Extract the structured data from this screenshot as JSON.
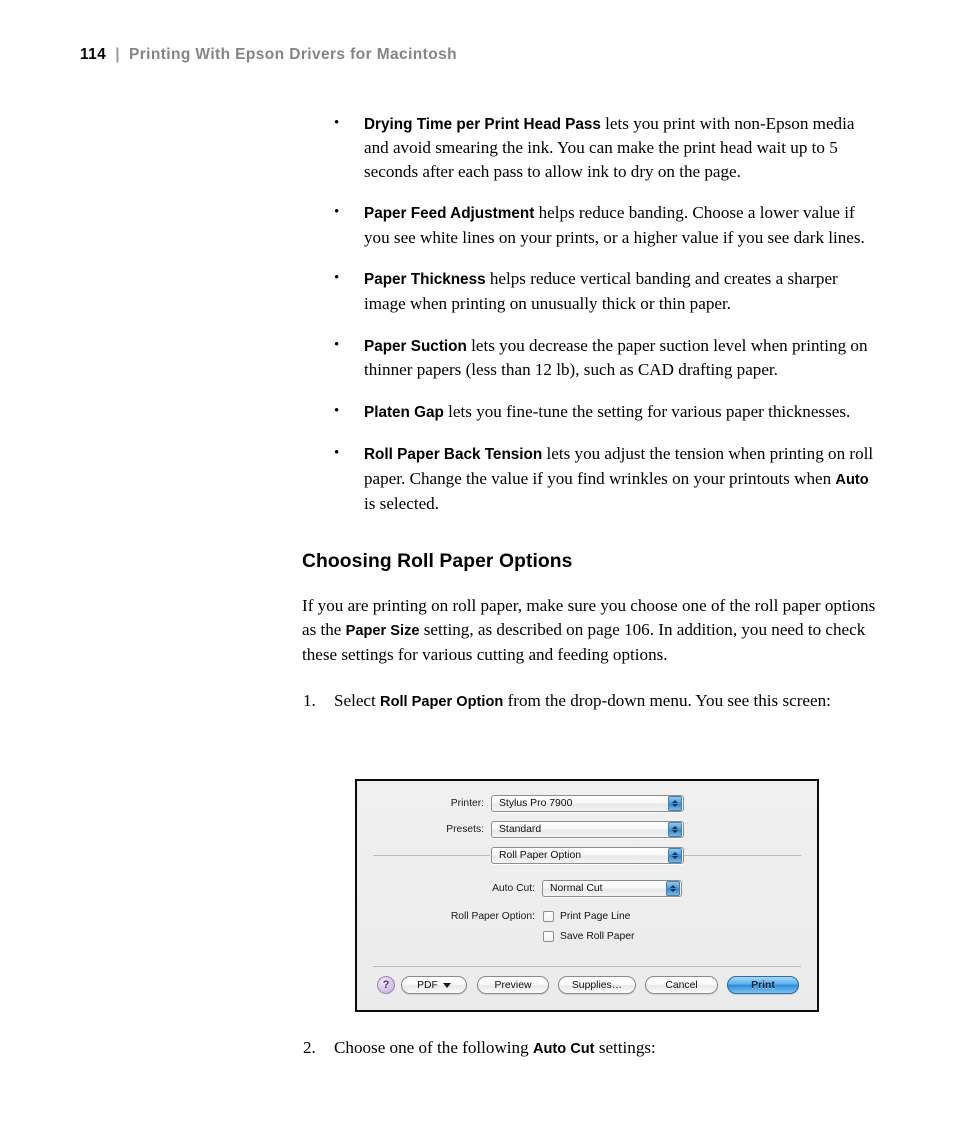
{
  "header": {
    "folio": "114",
    "separator": "|",
    "running_head": "Printing With Epson Drivers for Macintosh"
  },
  "bullets": [
    {
      "term": "Drying Time per Print Head Pass",
      "text": " lets you print with non-Epson media and avoid smearing the ink. You can make the print head wait up to 5 seconds after each pass to allow ink to dry on the page."
    },
    {
      "term": "Paper Feed Adjustment",
      "text": " helps reduce banding. Choose a lower value if you see white lines on your prints, or a higher value if you see dark lines."
    },
    {
      "term": "Paper Thickness",
      "text": " helps reduce vertical banding and creates a sharper image when printing on unusually thick or thin paper."
    },
    {
      "term": "Paper Suction",
      "text": " lets you decrease the paper suction level when printing on thinner papers (less than 12 lb), such as CAD drafting paper."
    },
    {
      "term": "Platen Gap",
      "text": " lets you fine-tune the setting for various paper thicknesses."
    },
    {
      "term": "Roll Paper Back Tension",
      "text_before": " lets you adjust the tension when printing on roll paper. Change the value if you find wrinkles on your printouts when ",
      "inline_term": "Auto",
      "text_after": " is selected."
    }
  ],
  "section": {
    "heading": "Choosing Roll Paper Options",
    "intro_part1": "If you are printing on roll paper, make sure you choose one of the roll paper options as the ",
    "intro_term": "Paper Size",
    "intro_part2": " setting, as described on page 106. In addition, you need to check these settings for various cutting and feeding options."
  },
  "steps": [
    {
      "number": "1.",
      "text_before": "Select ",
      "term": "Roll Paper Option",
      "text_after": " from the drop-down menu. You see this screen:"
    },
    {
      "number": "2.",
      "text_before": "Choose one of the following ",
      "term": "Auto Cut",
      "text_after": " settings:"
    }
  ],
  "dialog": {
    "printer_label": "Printer:",
    "printer_value": "Stylus Pro 7900",
    "presets_label": "Presets:",
    "presets_value": "Standard",
    "pane_value": "Roll Paper Option",
    "auto_cut_label": "Auto Cut:",
    "auto_cut_value": "Normal Cut",
    "roll_paper_option_label": "Roll Paper Option:",
    "checkboxes": [
      {
        "label": "Print Page Line",
        "checked": false
      },
      {
        "label": "Save Roll Paper",
        "checked": false
      }
    ],
    "buttons": {
      "help": "?",
      "pdf": "PDF",
      "preview": "Preview",
      "supplies": "Supplies…",
      "cancel": "Cancel",
      "print": "Print"
    },
    "colors": {
      "frame": "#0a0a0a",
      "background": "#eeeeee",
      "stepper_blue": "#3f93d8",
      "default_button_blue": "#4ea4e8",
      "help_purple": "#c9b3e0"
    }
  }
}
